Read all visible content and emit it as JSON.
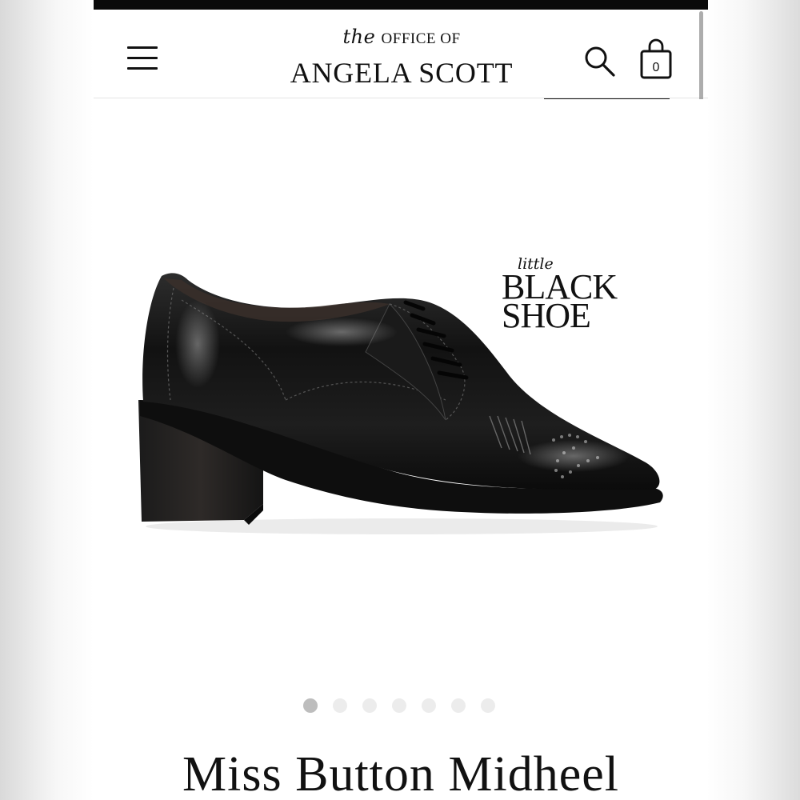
{
  "header": {
    "logo": {
      "the": "the",
      "office_of": "OFFICE OF",
      "brand": "ANGELA SCOTT"
    },
    "cart_count": "0",
    "icons": [
      "menu-icon",
      "search-icon",
      "shopping-bag-icon"
    ]
  },
  "product": {
    "badge": {
      "little": "little",
      "black": "BLACK",
      "shoe": "SHOE"
    },
    "image_alt": "black leather lace-up brogue with block heel",
    "gallery": {
      "count": 7,
      "active_index": 0
    },
    "title": "Miss Button Midheel"
  },
  "colors": {
    "topbar": "#0a0a0a",
    "text": "#111111",
    "dot_active": "#bdbdbd",
    "dot_inactive": "#ececec"
  }
}
